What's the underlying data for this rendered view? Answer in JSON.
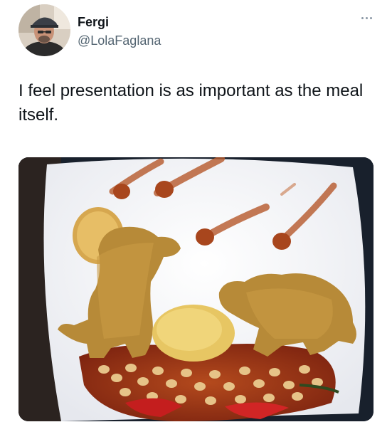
{
  "tweet": {
    "author": {
      "display_name": "Fergi",
      "handle": "@LolaFaglana",
      "avatar_icon": "user-avatar-photo"
    },
    "more_icon": "more-options-icon",
    "text": "I feel presentation is as important as the meal itself.",
    "media": {
      "kind": "photo",
      "icon": "food-plate-photo"
    }
  },
  "colors": {
    "text_primary": "#0f1419",
    "text_secondary": "#536471"
  }
}
